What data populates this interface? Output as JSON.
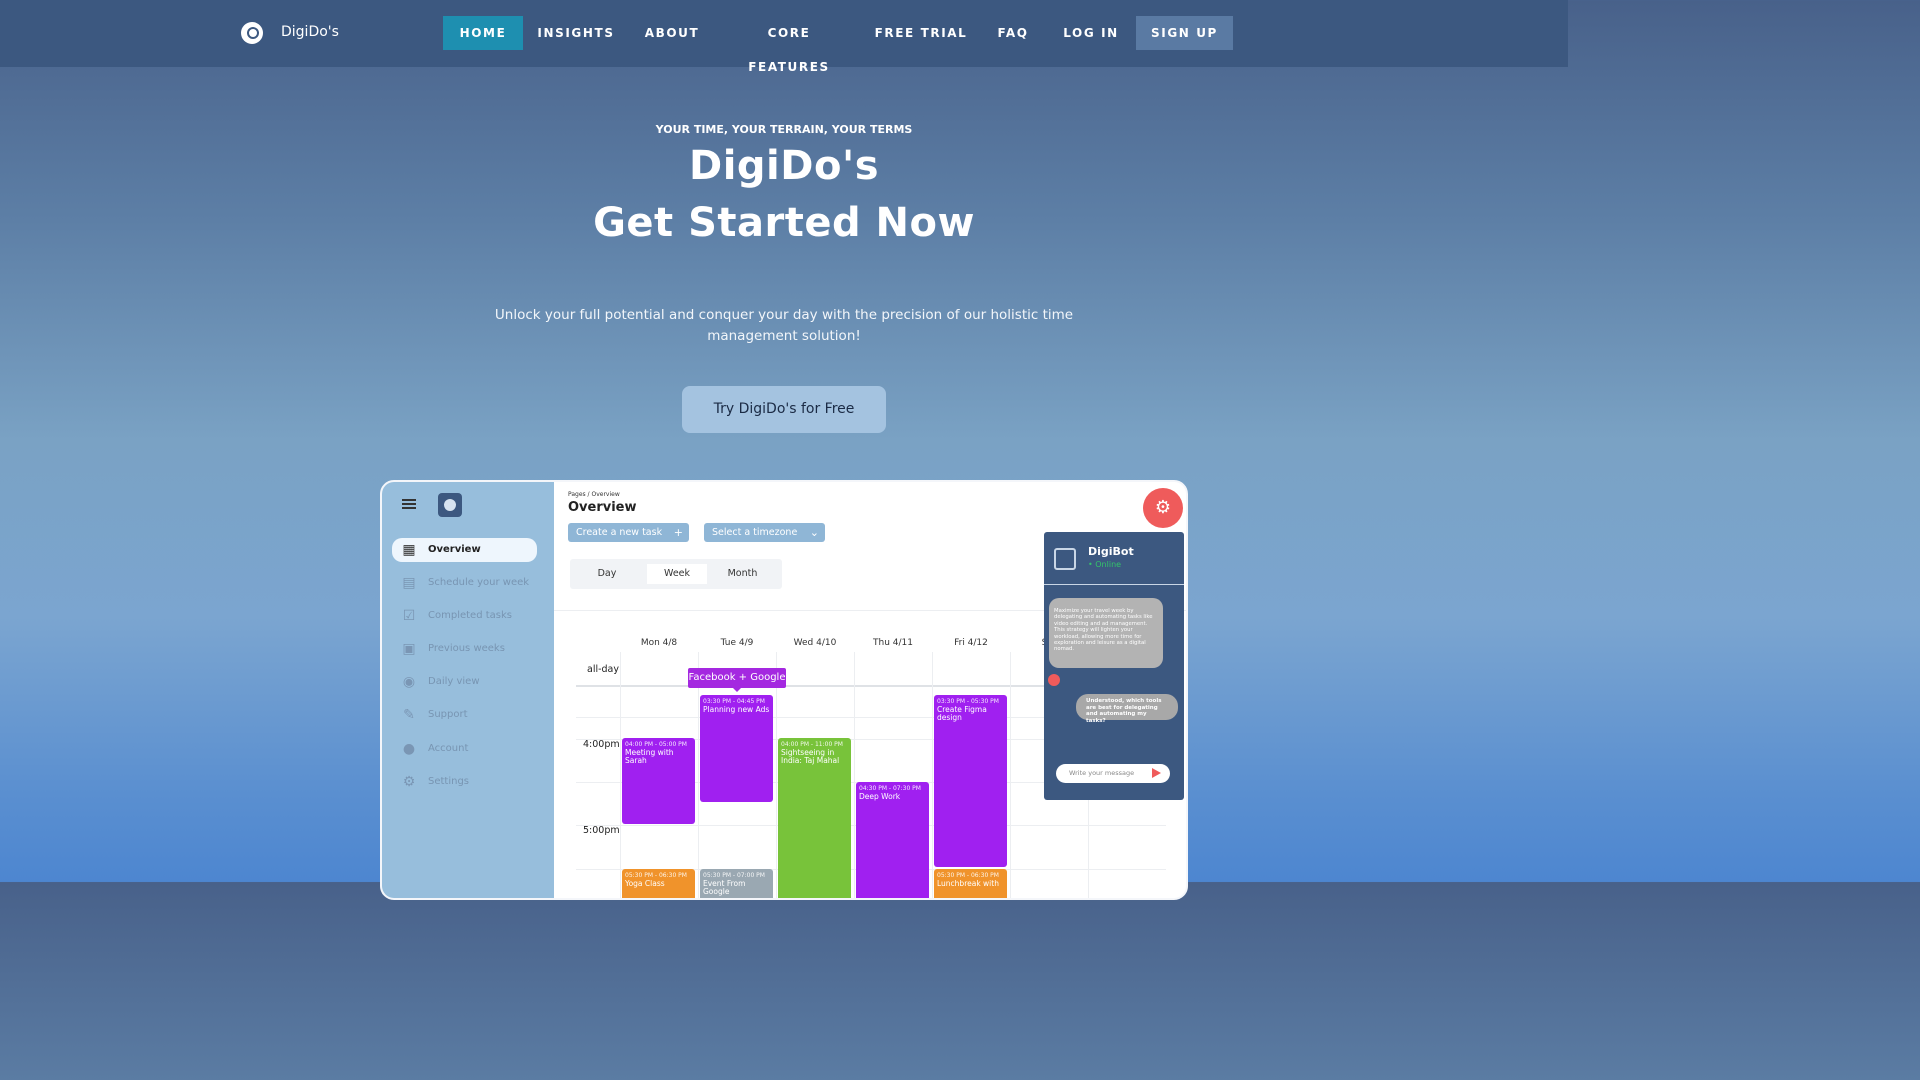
{
  "nav": {
    "brand": "DigiDo's",
    "items": [
      "HOME",
      "INSIGHTS",
      "ABOUT",
      "CORE FEATURES",
      "FREE TRIAL",
      "FAQ",
      "LOG IN",
      "SIGN UP"
    ],
    "colors": {
      "bar": "#3c5880",
      "active": "#1e8fb0",
      "signup": "#5a7aa3"
    }
  },
  "hero": {
    "eyebrow": "YOUR TIME, YOUR TERRAIN, YOUR TERMS",
    "title_line1": "DigiDo's",
    "title_line2": "Get Started Now",
    "subtitle": "Unlock your full potential and conquer your day with the precision of our holistic time management solution!",
    "cta": "Try DigiDo's for Free"
  },
  "app": {
    "breadcrumb": "Pages / Overview",
    "title": "Overview",
    "create_task": "Create a new task",
    "timezone": "Select a timezone",
    "sidebar": [
      {
        "label": "Overview",
        "icon": "grid-icon",
        "glyph": "▦"
      },
      {
        "label": "Schedule your week",
        "icon": "schedule-icon",
        "glyph": "▤"
      },
      {
        "label": "Completed tasks",
        "icon": "checkbox-icon",
        "glyph": "☑"
      },
      {
        "label": "Previous weeks",
        "icon": "calendar-icon",
        "glyph": "▣"
      },
      {
        "label": "Daily view",
        "icon": "eye-icon",
        "glyph": "◉"
      },
      {
        "label": "Support",
        "icon": "wrench-icon",
        "glyph": "✎"
      },
      {
        "label": "Account",
        "icon": "user-icon",
        "glyph": "●"
      },
      {
        "label": "Settings",
        "icon": "gear-icon",
        "glyph": "⚙"
      }
    ],
    "views": [
      "Day",
      "Week",
      "Month"
    ],
    "selected_view": "Week",
    "days": [
      "Mon 4/8",
      "Tue 4/9",
      "Wed 4/10",
      "Thu 4/11",
      "Fri 4/12",
      "Sat"
    ],
    "allday_label": "all-day",
    "allday_tag": "Facebook + Google",
    "times": [
      "4:00pm",
      "5:00pm"
    ],
    "events": [
      {
        "time": "04:00 PM - 05:00 PM",
        "title": "Meeting with Sarah",
        "color": "#a020f0"
      },
      {
        "time": "03:30 PM - 04:45 PM",
        "title": "Planning new Ads",
        "color": "#a020f0"
      },
      {
        "time": "04:00 PM - 11:00 PM",
        "title": "Sightseeing in India: Taj Mahal",
        "color": "#78c33a"
      },
      {
        "time": "04:30 PM - 07:30 PM",
        "title": "Deep Work",
        "color": "#a020f0"
      },
      {
        "time": "03:30 PM - 05:30 PM",
        "title": "Create Figma design",
        "color": "#a020f0"
      },
      {
        "time": "05:30 PM - 06:30 PM",
        "title": "Yoga Class",
        "color": "#f0932b"
      },
      {
        "time": "05:30 PM - 07:00 PM",
        "title": "Event From Google",
        "color": "#9aa8b2"
      },
      {
        "time": "05:30 PM - 06:30 PM",
        "title": "Lunchbreak with",
        "color": "#f0932b"
      }
    ],
    "chat": {
      "name": "DigiBot",
      "status": "• Online",
      "bot_message": "Maximize your travel week by delegating and automating tasks like video editing and ad management. This strategy will lighten your workload, allowing more time for exploration and leisure as a digital nomad.",
      "user_message": "Understood, which tools are best for delegating and automating my tasks?",
      "placeholder": "Write your message"
    }
  }
}
